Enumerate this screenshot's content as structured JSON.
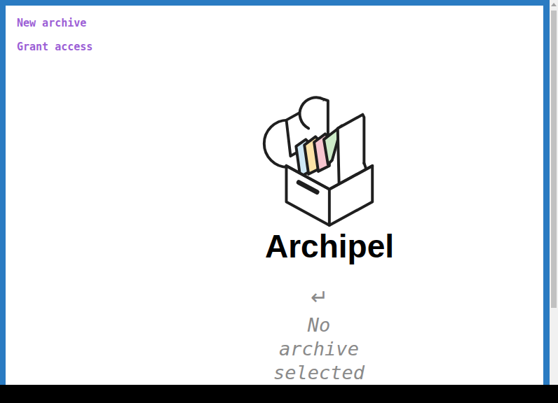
{
  "sidebar": {
    "links": [
      "New archive",
      "Grant access"
    ]
  },
  "brand": {
    "name": "Archipel"
  },
  "empty_state": {
    "icon": "↵",
    "message": "No archive selected"
  }
}
